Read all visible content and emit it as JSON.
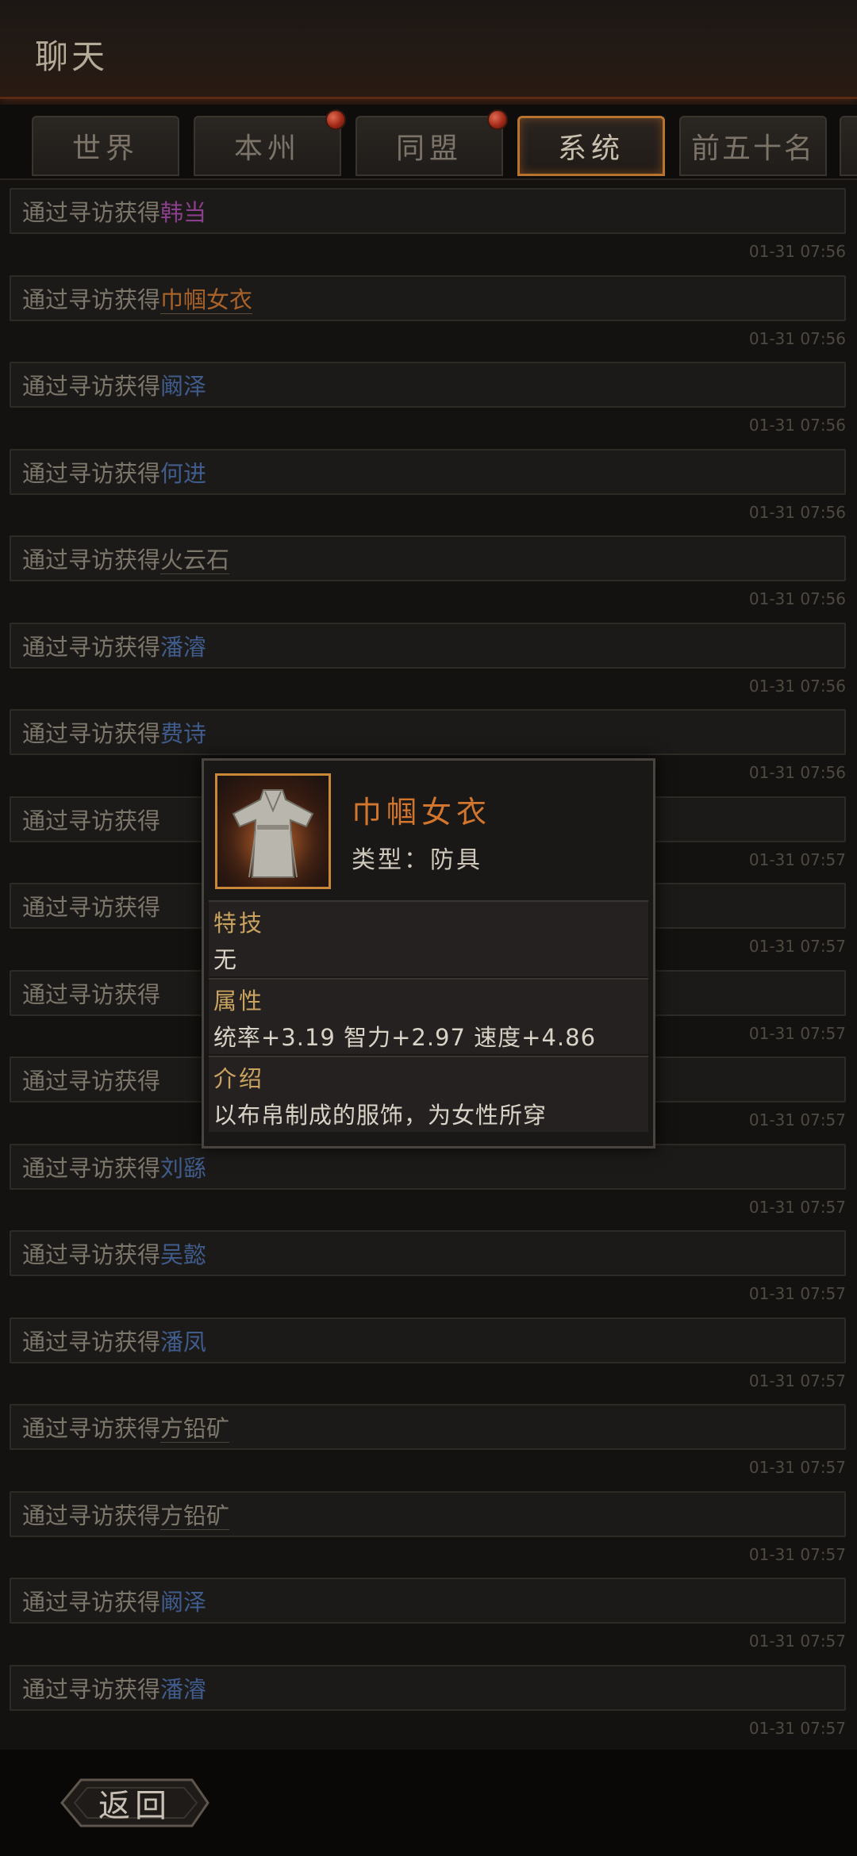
{
  "header": {
    "title": "聊天"
  },
  "tabs": [
    {
      "label": "世界",
      "active": false,
      "badge": false
    },
    {
      "label": "本州",
      "active": false,
      "badge": true
    },
    {
      "label": "同盟",
      "active": false,
      "badge": true
    },
    {
      "label": "系统",
      "active": true,
      "badge": false
    },
    {
      "label": "前五十名",
      "active": false,
      "badge": false
    }
  ],
  "messages": [
    {
      "prefix": "通过寻访获得",
      "name": "韩当",
      "style": "purple",
      "time": "01-31 07:56"
    },
    {
      "prefix": "通过寻访获得",
      "name": "巾帼女衣",
      "style": "orange",
      "time": "01-31 07:56"
    },
    {
      "prefix": "通过寻访获得",
      "name": "阚泽",
      "style": "blue",
      "time": "01-31 07:56"
    },
    {
      "prefix": "通过寻访获得",
      "name": "何进",
      "style": "blue",
      "time": "01-31 07:56"
    },
    {
      "prefix": "通过寻访获得",
      "name": "火云石",
      "style": "gray",
      "time": "01-31 07:56"
    },
    {
      "prefix": "通过寻访获得",
      "name": "潘濬",
      "style": "blue",
      "time": "01-31 07:56"
    },
    {
      "prefix": "通过寻访获得",
      "name": "费诗",
      "style": "blue",
      "time": "01-31 07:56"
    },
    {
      "prefix": "通过寻访获得",
      "name": "",
      "style": "blue",
      "time": "01-31 07:57"
    },
    {
      "prefix": "通过寻访获得",
      "name": "",
      "style": "blue",
      "time": "01-31 07:57"
    },
    {
      "prefix": "通过寻访获得",
      "name": "",
      "style": "blue",
      "time": "01-31 07:57"
    },
    {
      "prefix": "通过寻访获得",
      "name": "",
      "style": "blue",
      "time": "01-31 07:57"
    },
    {
      "prefix": "通过寻访获得",
      "name": "刘繇",
      "style": "blue",
      "time": "01-31 07:57"
    },
    {
      "prefix": "通过寻访获得",
      "name": "吴懿",
      "style": "blue",
      "time": "01-31 07:57"
    },
    {
      "prefix": "通过寻访获得",
      "name": "潘凤",
      "style": "blue",
      "time": "01-31 07:57"
    },
    {
      "prefix": "通过寻访获得",
      "name": "方铅矿",
      "style": "gray",
      "time": "01-31 07:57"
    },
    {
      "prefix": "通过寻访获得",
      "name": "方铅矿",
      "style": "gray",
      "time": "01-31 07:57"
    },
    {
      "prefix": "通过寻访获得",
      "name": "阚泽",
      "style": "blue",
      "time": "01-31 07:57"
    },
    {
      "prefix": "通过寻访获得",
      "name": "潘濬",
      "style": "blue",
      "time": "01-31 07:57"
    }
  ],
  "tooltip": {
    "name": "巾帼女衣",
    "type_line": "类型：防具",
    "skill_head": "特技",
    "skill_body": "无",
    "attr_head": "属性",
    "attr_body": "统率+3.19 智力+2.97 速度+4.86",
    "intro_head": "介绍",
    "intro_body": "以布帛制成的服饰，为女性所穿",
    "icon": "robe-icon"
  },
  "footer": {
    "back_label": "返回"
  },
  "colors": {
    "accent_orange": "#d2752d",
    "tab_active_border": "#b8732f",
    "name_blue": "#3f5c8c",
    "name_purple": "#8a3f8c",
    "badge_red": "#c23a22"
  }
}
